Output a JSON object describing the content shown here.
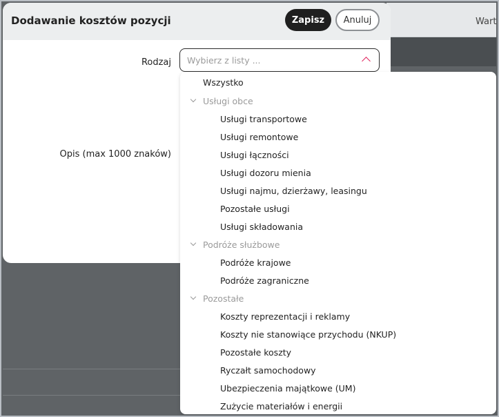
{
  "background": {
    "right_label": "Wart"
  },
  "modal": {
    "title": "Dodawanie kosztów pozycji",
    "save_label": "Zapisz",
    "cancel_label": "Anuluj",
    "fields": {
      "rodzaj_label": "Rodzaj",
      "rodzaj_placeholder": "Wybierz z listy ...",
      "opis_label": "Opis (max 1000 znaków)"
    }
  },
  "dropdown": {
    "all": "Wszystko",
    "groups": [
      {
        "label": "Usługi obce",
        "items": [
          "Usługi transportowe",
          "Usługi remontowe",
          "Usługi łączności",
          "Usługi dozoru mienia",
          "Usługi najmu, dzierżawy, leasingu",
          "Pozostałe usługi",
          "Usługi składowania"
        ]
      },
      {
        "label": "Podróże służbowe",
        "items": [
          "Podróże krajowe",
          "Podróże zagraniczne"
        ]
      },
      {
        "label": "Pozostałe",
        "items": [
          "Koszty reprezentacji i reklamy",
          "Koszty nie stanowiące przychodu (NKUP)",
          "Pozostałe koszty",
          "Ryczałt samochodowy",
          "Ubezpieczenia majątkowe (UM)",
          "Zużycie materiałów i energii"
        ]
      }
    ]
  },
  "colors": {
    "accent": "#e0245e",
    "overlay": "#5f6366",
    "primary_button": "#1f1f1f"
  }
}
